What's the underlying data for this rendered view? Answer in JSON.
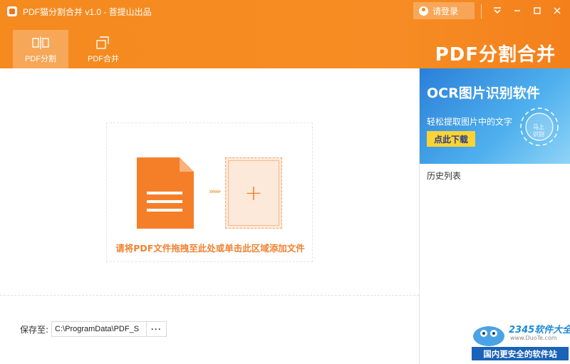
{
  "window": {
    "title": "PDF猫分割合并 v1.0 - 菩提山出品",
    "login_label": "请登录"
  },
  "tabs": [
    {
      "label": "PDF分割",
      "active": true
    },
    {
      "label": "PDF合并",
      "active": false
    }
  ],
  "brand": "PDF分割合并",
  "main": {
    "drop_hint": "请将PDF文件拖拽至此处或单击此区域添加文件",
    "arrows": "»»»",
    "plus": "+",
    "save_label": "保存至:",
    "save_path": "C:\\ProgramData\\PDF_S",
    "browse_label": "···"
  },
  "ad": {
    "title": "OCR图片识别软件",
    "subtitle": "轻松提取图片中的文字",
    "button": "点此下载",
    "circle_line1": "马上",
    "circle_line2": "识别"
  },
  "history": {
    "title": "历史列表"
  },
  "watermark": {
    "name": "2345软件大全",
    "url": "www.DuoTe.com",
    "slogan": "国内更安全的软件站"
  },
  "colors": {
    "accent": "#f58a1f",
    "hint": "#f08232",
    "ad_button": "#fcd332"
  }
}
